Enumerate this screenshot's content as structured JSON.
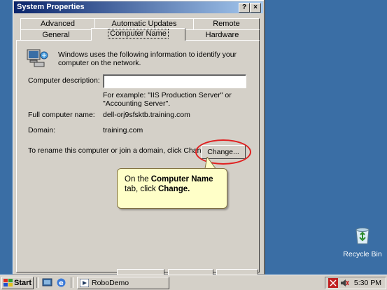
{
  "window": {
    "title": "System Properties",
    "help_btn": "?",
    "close_btn": "×"
  },
  "tabs": {
    "row1": [
      "Advanced",
      "Automatic Updates",
      "Remote"
    ],
    "row2": [
      "General",
      "Computer Name",
      "Hardware"
    ],
    "active": "Computer Name"
  },
  "panel": {
    "intro": "Windows uses the following information to identify your computer on the network.",
    "description_label": "Computer description:",
    "description_value": "",
    "example_text": "For example: \"IIS Production Server\" or \"Accounting Server\".",
    "full_name_label": "Full computer name:",
    "full_name_value": "dell-orj9sfsktb.training.com",
    "domain_label": "Domain:",
    "domain_value": "training.com",
    "rename_text": "To rename this computer or join a domain, click Change.",
    "change_btn": "Change..."
  },
  "callout": {
    "prefix": "On the ",
    "bold1": "Computer Name",
    "middle": " tab, click ",
    "bold2": "Change."
  },
  "desktop": {
    "recycle_label": "Recycle Bin"
  },
  "taskbar": {
    "start_label": "Start",
    "task_label": "RoboDemo",
    "clock": "5:30 PM"
  }
}
